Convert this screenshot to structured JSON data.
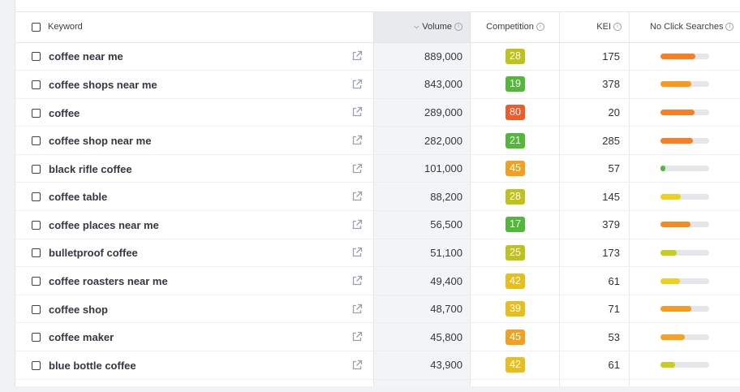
{
  "header": {
    "keyword": "Keyword",
    "volume": "Volume",
    "competition": "Competition",
    "kei": "KEI",
    "no_click": "No Click Searches"
  },
  "icons": {
    "checkbox": "checkbox-icon",
    "external": "external-link-icon",
    "info": "info-icon",
    "sort": "chevron-down-icon"
  },
  "colors": {
    "green": "#53b83a",
    "yellow_green": "#bec21a",
    "yellow": "#e8bd1c",
    "orange": "#f2a01e",
    "red": "#ef5b2b",
    "bar_orange": "#f57f22",
    "bar_light_orange": "#f7a124",
    "bar_yellow": "#f0cf1c",
    "bar_olive": "#c6cf1d",
    "bar_green": "#50b934"
  },
  "rows": [
    {
      "keyword": "coffee near me",
      "volume": "889,000",
      "competition": "28",
      "comp_color": "#bec21a",
      "kei": "175",
      "no_click": 0.72,
      "bar_color": "#f57f22"
    },
    {
      "keyword": "coffee shops near me",
      "volume": "843,000",
      "competition": "19",
      "comp_color": "#53b83a",
      "kei": "378",
      "no_click": 0.63,
      "bar_color": "#f79a22"
    },
    {
      "keyword": "coffee",
      "volume": "289,000",
      "competition": "80",
      "comp_color": "#ef5b2b",
      "kei": "20",
      "no_click": 0.7,
      "bar_color": "#f57f22"
    },
    {
      "keyword": "coffee shop near me",
      "volume": "282,000",
      "competition": "21",
      "comp_color": "#53b83a",
      "kei": "285",
      "no_click": 0.66,
      "bar_color": "#f57f22"
    },
    {
      "keyword": "black rifle coffee",
      "volume": "101,000",
      "competition": "45",
      "comp_color": "#f2a01e",
      "kei": "57",
      "no_click": 0.1,
      "bar_color": "#50b934"
    },
    {
      "keyword": "coffee table",
      "volume": "88,200",
      "competition": "28",
      "comp_color": "#bec21a",
      "kei": "145",
      "no_click": 0.42,
      "bar_color": "#f0cf1c"
    },
    {
      "keyword": "coffee places near me",
      "volume": "56,500",
      "competition": "17",
      "comp_color": "#53b83a",
      "kei": "379",
      "no_click": 0.62,
      "bar_color": "#f58a22"
    },
    {
      "keyword": "bulletproof coffee",
      "volume": "51,100",
      "competition": "25",
      "comp_color": "#bec21a",
      "kei": "173",
      "no_click": 0.33,
      "bar_color": "#c6cf1d"
    },
    {
      "keyword": "coffee roasters near me",
      "volume": "49,400",
      "competition": "42",
      "comp_color": "#e8bd1c",
      "kei": "61",
      "no_click": 0.4,
      "bar_color": "#f0cf1c"
    },
    {
      "keyword": "coffee shop",
      "volume": "48,700",
      "competition": "39",
      "comp_color": "#e8bd1c",
      "kei": "71",
      "no_click": 0.63,
      "bar_color": "#f79a22"
    },
    {
      "keyword": "coffee maker",
      "volume": "45,800",
      "competition": "45",
      "comp_color": "#f2a01e",
      "kei": "53",
      "no_click": 0.5,
      "bar_color": "#f7a124"
    },
    {
      "keyword": "blue bottle coffee",
      "volume": "43,900",
      "competition": "42",
      "comp_color": "#e8bd1c",
      "kei": "61",
      "no_click": 0.3,
      "bar_color": "#c6cf1d"
    }
  ]
}
